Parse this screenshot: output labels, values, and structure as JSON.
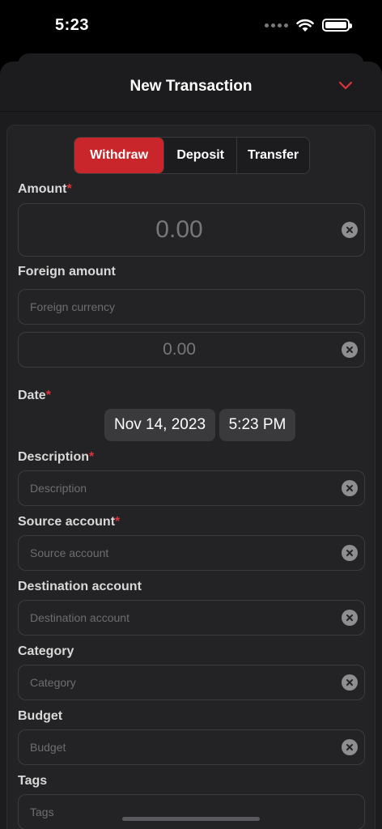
{
  "status": {
    "time": "5:23"
  },
  "header": {
    "title": "New Transaction"
  },
  "tabs": [
    {
      "label": "Withdraw",
      "active": true
    },
    {
      "label": "Deposit",
      "active": false
    },
    {
      "label": "Transfer",
      "active": false
    }
  ],
  "form": {
    "amount": {
      "label": "Amount",
      "required": "*",
      "placeholder": "0.00"
    },
    "foreign": {
      "label": "Foreign amount",
      "currency_placeholder": "Foreign currency",
      "amount_placeholder": "0.00"
    },
    "date": {
      "label": "Date",
      "required": "*",
      "date_value": "Nov 14, 2023",
      "time_value": "5:23 PM"
    },
    "description": {
      "label": "Description",
      "required": "*",
      "placeholder": "Description"
    },
    "source": {
      "label": "Source account",
      "required": "*",
      "placeholder": "Source account"
    },
    "destination": {
      "label": "Destination account",
      "placeholder": "Destination account"
    },
    "category": {
      "label": "Category",
      "placeholder": "Category"
    },
    "budget": {
      "label": "Budget",
      "placeholder": "Budget"
    },
    "tags": {
      "label": "Tags",
      "placeholder": "Tags"
    }
  },
  "colors": {
    "accent": "#c8262a",
    "background": "#1c1c1e",
    "required": "#e0333a"
  },
  "icons": [
    "wifi-icon",
    "battery-icon",
    "chevron-down-icon",
    "clear-icon"
  ]
}
